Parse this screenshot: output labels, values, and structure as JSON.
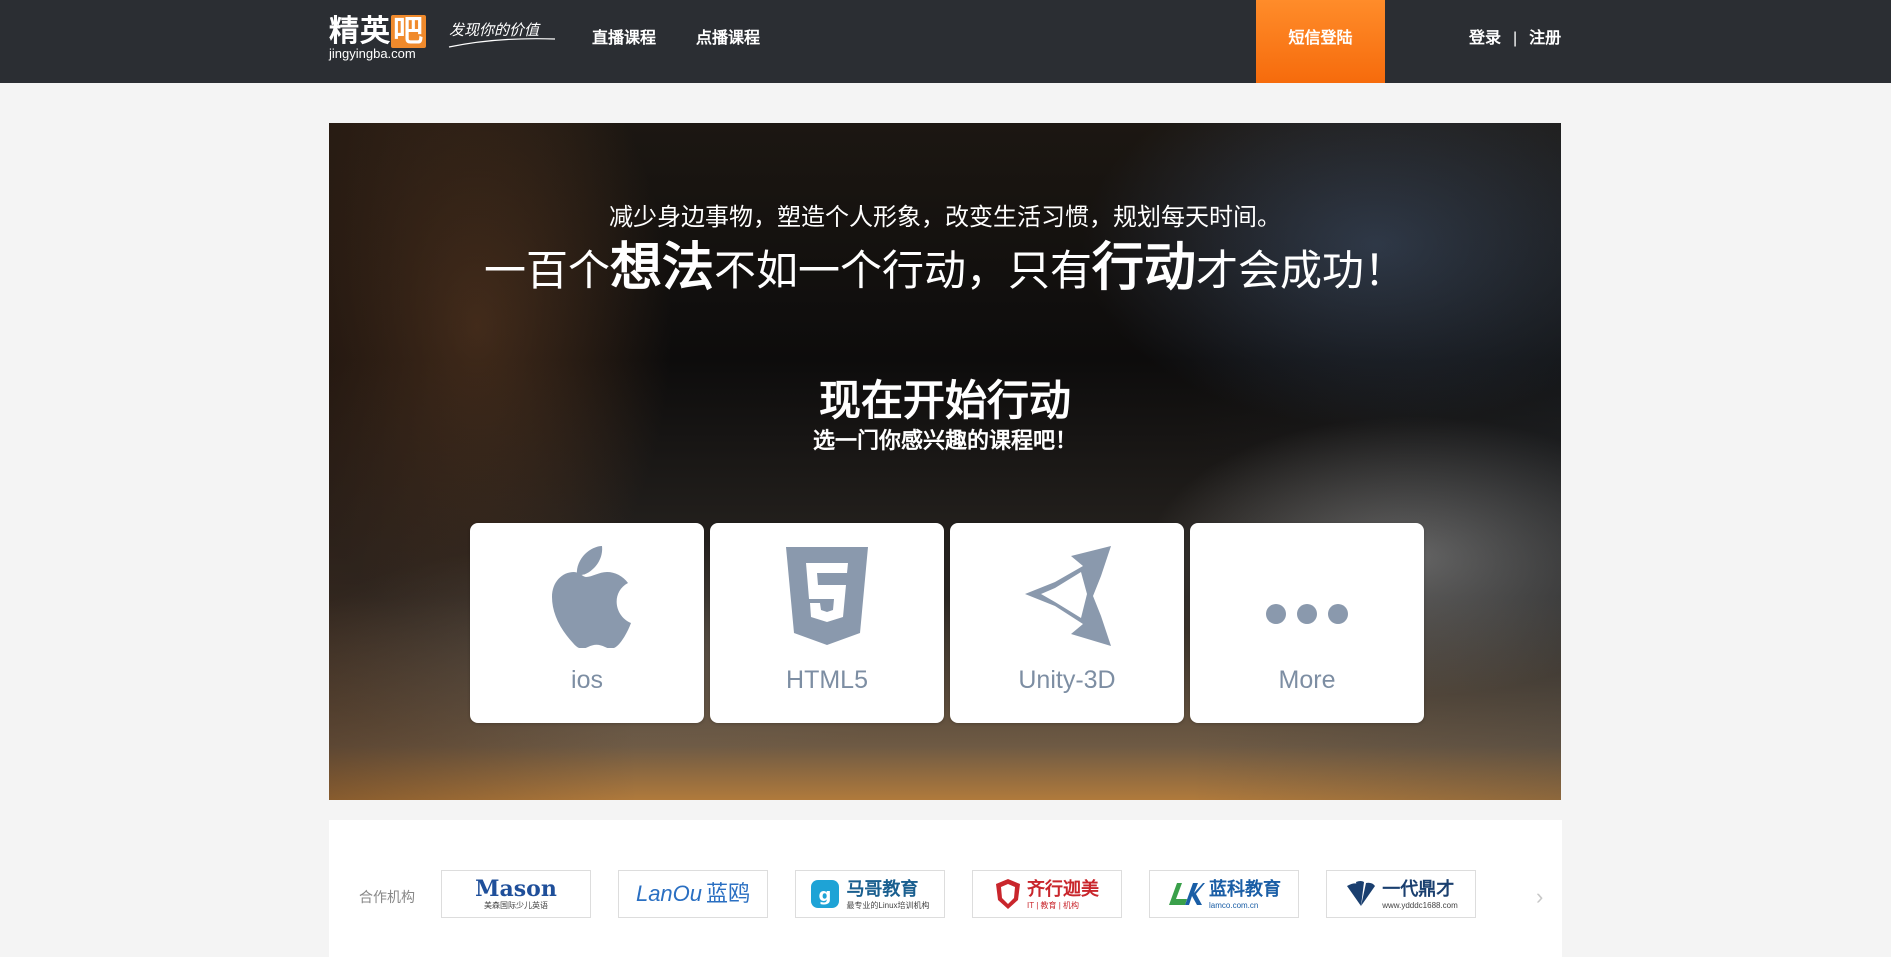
{
  "header": {
    "logo": {
      "brand_cn": "精英",
      "brand_cn_last": "吧",
      "brand_en": "jingyingba.com",
      "slogan": "发现你的价值"
    },
    "nav": {
      "live": "直播课程",
      "vod": "点播课程"
    },
    "sms_login": "短信登陆",
    "auth": {
      "login": "登录",
      "sep": "|",
      "register": "注册"
    },
    "colors": {
      "bar": "#2b2e33",
      "accent": "#f66b0c"
    }
  },
  "hero": {
    "line1": "减少身边事物，塑造个人形象，改变生活习惯，规划每天时间。",
    "line2": {
      "a": "一百个",
      "em1": "想法",
      "b": "不如一个行动，只有",
      "em2": "行动",
      "c": "才会成功！"
    },
    "cta": "现在开始行动",
    "sub": "选一门你感兴趣的课程吧！",
    "courses": [
      {
        "label": "ios",
        "icon": "apple-icon"
      },
      {
        "label": "HTML5",
        "icon": "html5-icon"
      },
      {
        "label": "Unity-3D",
        "icon": "unity-icon"
      },
      {
        "label": "More",
        "icon": "more-dots-icon"
      }
    ],
    "icon_color": "#8a99ad"
  },
  "partners": {
    "title": "合作机构",
    "logos": [
      {
        "name": "Mason",
        "sub": "美森国际少儿英语"
      },
      {
        "name": "LanOu",
        "cn": "蓝鸥"
      },
      {
        "name": "马哥教育",
        "sub": "最专业的Linux培训机构"
      },
      {
        "name": "齐行迦美",
        "sub": "IT | 教育 | 机构"
      },
      {
        "name": "蓝科教育",
        "sub": "lamco.com.cn"
      },
      {
        "name": "一代鼎才",
        "sub": "www.ydddc1688.com"
      }
    ]
  }
}
